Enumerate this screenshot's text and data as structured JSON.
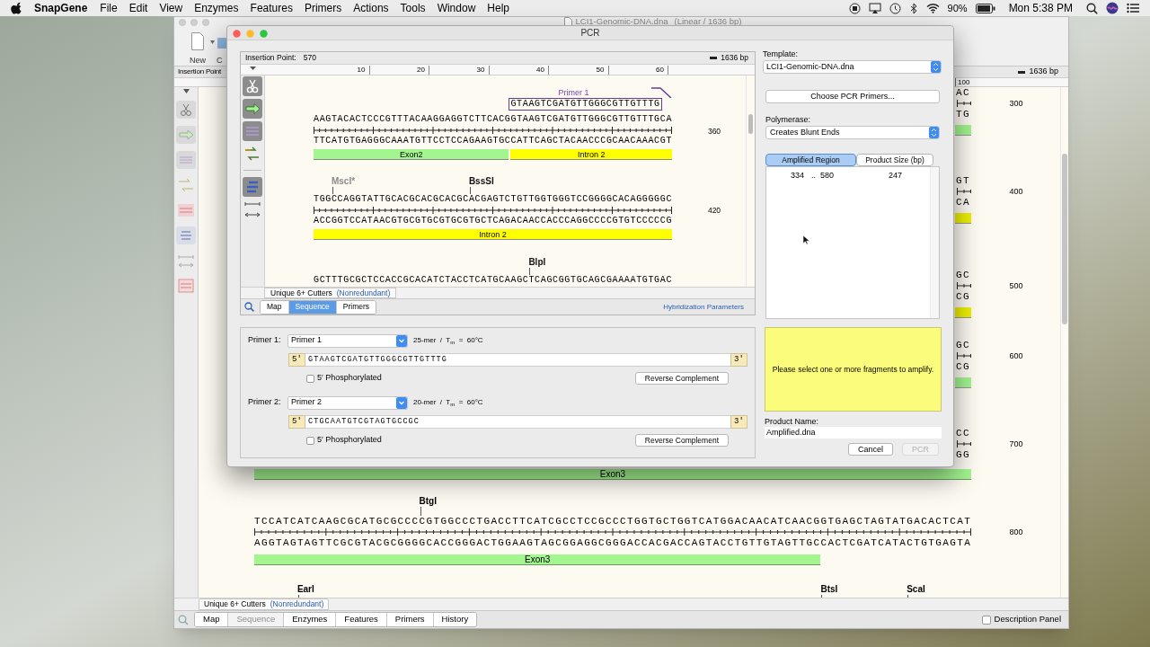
{
  "menu_bar": {
    "app_name": "SnapGene",
    "items": [
      "File",
      "Edit",
      "View",
      "Enzymes",
      "Features",
      "Primers",
      "Actions",
      "Tools",
      "Window",
      "Help"
    ],
    "battery": "90%",
    "clock": "Mon 5:38 PM"
  },
  "document_window": {
    "title": "LCI1-Genomic-DNA.dna",
    "subtitle": "(Linear / 1636 bp)",
    "toolbar": [
      "New",
      "C"
    ],
    "insertion_label": "Insertion Point",
    "length": "1636 bp",
    "ruler_label": "100",
    "hidden_rows": [
      {
        "top": "AC",
        "bottom": "TG",
        "number": "300",
        "color": "#a3f58f"
      },
      {
        "top": "GT",
        "bottom": "CA",
        "number": "400",
        "color": "#eef000"
      },
      {
        "top": "GC",
        "bottom": "CG",
        "number": "500",
        "color": "#eef000"
      },
      {
        "top": "GC",
        "bottom": "CG",
        "number": "600",
        "color": "#a3f58f"
      },
      {
        "top": "CC",
        "bottom": "GG",
        "number": "700",
        "feature": "Exon3",
        "color": "#a3f58f"
      }
    ],
    "rows": [
      {
        "enzymes": [
          {
            "name": "BtgI"
          }
        ],
        "top": "TCCATCATCAAGCGCATGCGCCCCGTGGCCCTGACCTTCATCGCCTCCGCCCTGGTGCTGGTCATGGACAACATCAACGGTGAGCTAGTATGACACTCAT",
        "bottom": "AGGTAGTAGTTCGCGTACGCGGGGCACCGGGACTGGAAGTAGCGGAGGCGGGACCACGACCAGTACCTGTTGTAGTTGCCACTCGATCATACTGTGAGTA",
        "number": "800",
        "features": [
          {
            "label": "Exon3",
            "color": "#a3f58f"
          }
        ]
      },
      {
        "enzymes": [
          {
            "name": "EarI"
          },
          {
            "name": "BtsI"
          },
          {
            "name": "ScaI"
          }
        ]
      }
    ],
    "cutters": {
      "label": "Unique 6+ Cutters",
      "qualifier": "(Nonredundant)"
    },
    "tabs": [
      {
        "label": "Map",
        "selected": false
      },
      {
        "label": "Sequence",
        "selected": true
      },
      {
        "label": "Enzymes",
        "selected": false
      },
      {
        "label": "Features",
        "selected": false
      },
      {
        "label": "Primers",
        "selected": false
      },
      {
        "label": "History",
        "selected": false
      }
    ],
    "description_panel": {
      "label": "Description Panel",
      "checked": false
    }
  },
  "pcr_dialog": {
    "title": "PCR",
    "insertion_label": "Insertion Point:",
    "insertion_value": "570",
    "length": "1636 bp",
    "ruler_ticks": [
      "10",
      "20",
      "30",
      "40",
      "50",
      "60"
    ],
    "rows": [
      {
        "primer": {
          "label": "Primer 1",
          "sequence": "GTAAGTCGATGTTGGGCGTTGTTTG"
        },
        "top": "AAGTACACTCCCGTTTACAAGGAGGTCTTCACGGTAAGTCGATGTTGGGCGTTGTTTGCA",
        "bottom": "TTCATGTGAGGGCAAATGTTCCTCCAGAAGTGCCATTCAGCTACAACCCGCAACAAACGT",
        "number": "360",
        "features": [
          {
            "label": "Exon2",
            "color": "#a3f58f"
          },
          {
            "label": "Intron 2",
            "color": "#ffff00"
          }
        ]
      },
      {
        "enzymes": [
          {
            "name": "MscI*",
            "color": "#8a8a8a"
          },
          {
            "name": "BssSI",
            "color": "#111111"
          }
        ],
        "top": "TGGCCAGGTATTGCACGCACGCACGCACGAGTCTGTTGGTGGGTCCGGGGCACAGGGGGC",
        "bottom": "ACCGGTCCATAACGTGCGTGCGTGCGTGCTCAGACAACCACCCAGGCCCCGTGTCCCCCG",
        "number": "420",
        "features": [
          {
            "label": "Intron 2",
            "color": "#ffff00"
          }
        ]
      },
      {
        "enzymes": [
          {
            "name": "BlpI",
            "color": "#111111"
          }
        ],
        "top": "GCTTTGCGCTCCACCGCACATCTACCTCATGCAAGCTCAGCGGTGCAGCGAAAATGTGAC"
      }
    ],
    "cutters": {
      "label": "Unique 6+ Cutters",
      "qualifier": "(Nonredundant)"
    },
    "tabs": [
      {
        "label": "Map",
        "selected": false
      },
      {
        "label": "Sequence",
        "selected": true
      },
      {
        "label": "Primers",
        "selected": false
      }
    ],
    "link": "Hybridization Parameters",
    "primers": [
      {
        "label": "Primer 1:",
        "choice": "Primer 1",
        "info": "25-mer  /  T$_{m}$  =  60°C",
        "five_end": "5′",
        "sequence": "GTAAGTCGATGTTGGGCGTTGTTTG",
        "three_end": "3′",
        "phosphorylated": {
          "label": "5′ Phosphorylated",
          "checked": false
        },
        "button": "Reverse Complement"
      },
      {
        "label": "Primer 2:",
        "choice": "Primer 2",
        "info": "20-mer  /  T$_{m}$  =  60°C",
        "five_end": "5′",
        "sequence": "CTGCAATGTCGTAGTGCCGC",
        "three_end": "3′",
        "phosphorylated": {
          "label": "5′ Phosphorylated",
          "checked": false
        },
        "button": "Reverse Complement"
      }
    ],
    "template": {
      "label": "Template:",
      "value": "LCI1-Genomic-DNA.dna"
    },
    "choose_button": "Choose PCR Primers...",
    "polymerase": {
      "label": "Polymerase:",
      "value": "Creates Blunt Ends"
    },
    "results": {
      "columns": [
        {
          "label": "Amplified Region",
          "selected": true
        },
        {
          "label": "Product Size (bp)",
          "selected": false
        }
      ],
      "rows": [
        {
          "start": "334",
          "separator": "..",
          "end": "580",
          "size": "247"
        }
      ]
    },
    "message": "Please select one or more fragments to amplify.",
    "product_name": {
      "label": "Product Name:",
      "value": "Amplified.dna"
    },
    "buttons": [
      {
        "label": "Cancel",
        "disabled": false
      },
      {
        "label": "PCR",
        "disabled": true
      }
    ]
  }
}
